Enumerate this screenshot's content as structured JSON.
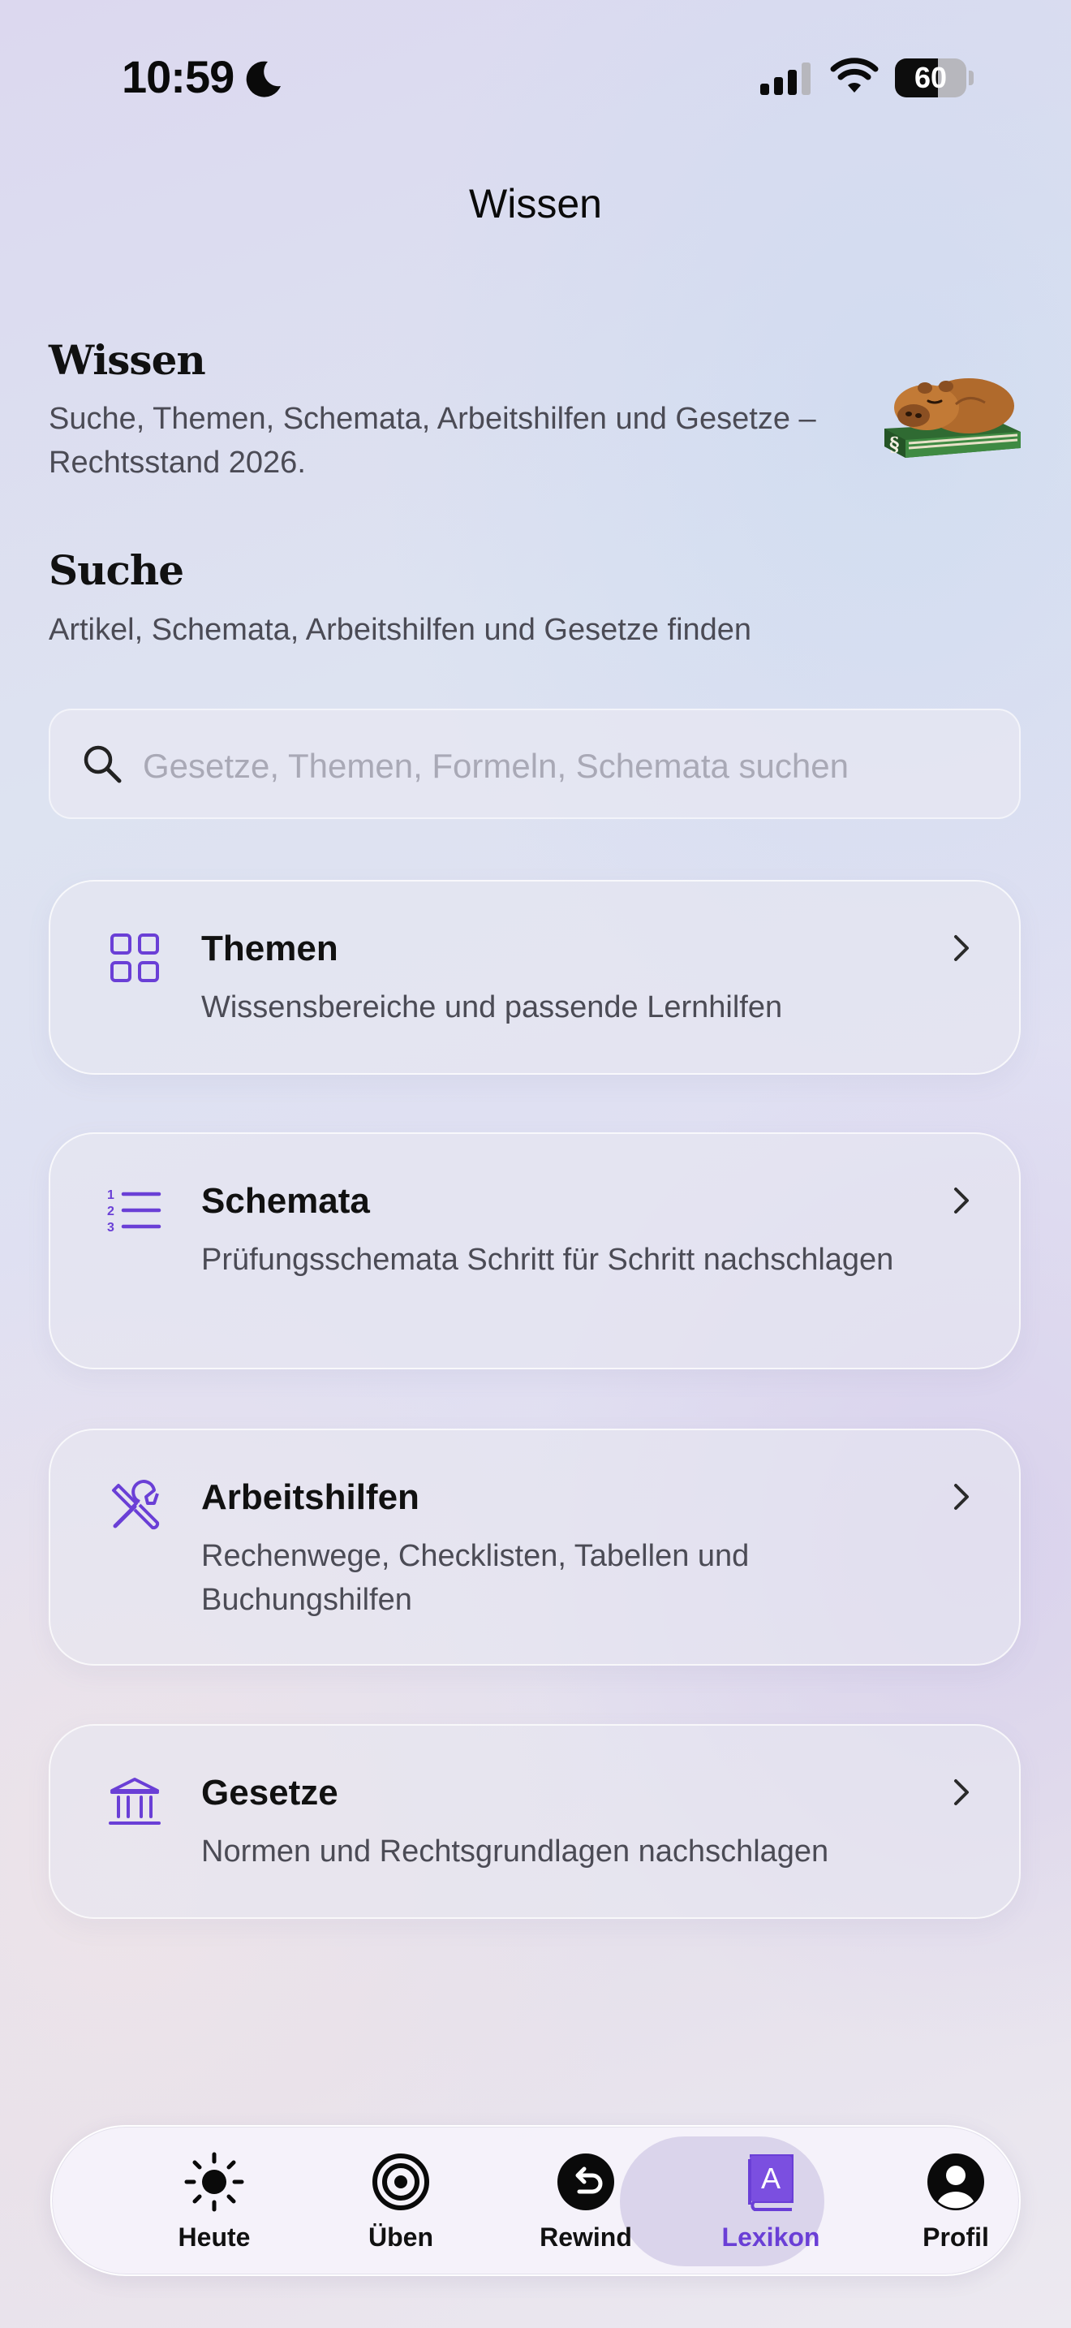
{
  "status_bar": {
    "time": "10:59",
    "battery_percent": "60",
    "battery_level": 0.6,
    "icons": [
      "moon-icon",
      "cellular-signal-icon",
      "wifi-icon",
      "battery-icon"
    ]
  },
  "nav": {
    "title": "Wissen"
  },
  "header": {
    "title": "Wissen",
    "subtitle": "Suche, Themen, Schemata, Arbeitshilfen und Gesetze – Rechtsstand 2026.",
    "mascot_icon": "capybara-on-law-book-icon"
  },
  "search_section": {
    "title": "Suche",
    "subtitle": "Artikel, Schemata, Arbeitshilfen und Gesetze finden",
    "input_value": "",
    "placeholder": "Gesetze, Themen, Formeln, Schemata suchen"
  },
  "cards": [
    {
      "title": "Themen",
      "description": "Wissensbereiche und passende Lernhilfen",
      "icon": "grid-icon"
    },
    {
      "title": "Schemata",
      "description": "Prüfungsschemata Schritt für Schritt nachschlagen",
      "icon": "numbered-list-icon"
    },
    {
      "title": "Arbeitshilfen",
      "description": "Rechenwege, Checklisten, Tabellen und Buchungshilfen",
      "icon": "tools-icon"
    },
    {
      "title": "Gesetze",
      "description": "Normen und Rechtsgrundlagen nachschlagen",
      "icon": "courthouse-icon"
    }
  ],
  "tab_bar": {
    "active": "Lexikon",
    "tabs": [
      {
        "label": "Heute",
        "icon": "sun-icon"
      },
      {
        "label": "Üben",
        "icon": "target-icon"
      },
      {
        "label": "Rewind",
        "icon": "rewind-icon"
      },
      {
        "label": "Lexikon",
        "icon": "lexicon-book-icon"
      },
      {
        "label": "Profil",
        "icon": "profile-icon"
      }
    ]
  },
  "colors": {
    "accent": "#6a3fd6",
    "text_primary": "#111111",
    "text_secondary": "#4b4b55",
    "placeholder": "#a9a9b6"
  }
}
